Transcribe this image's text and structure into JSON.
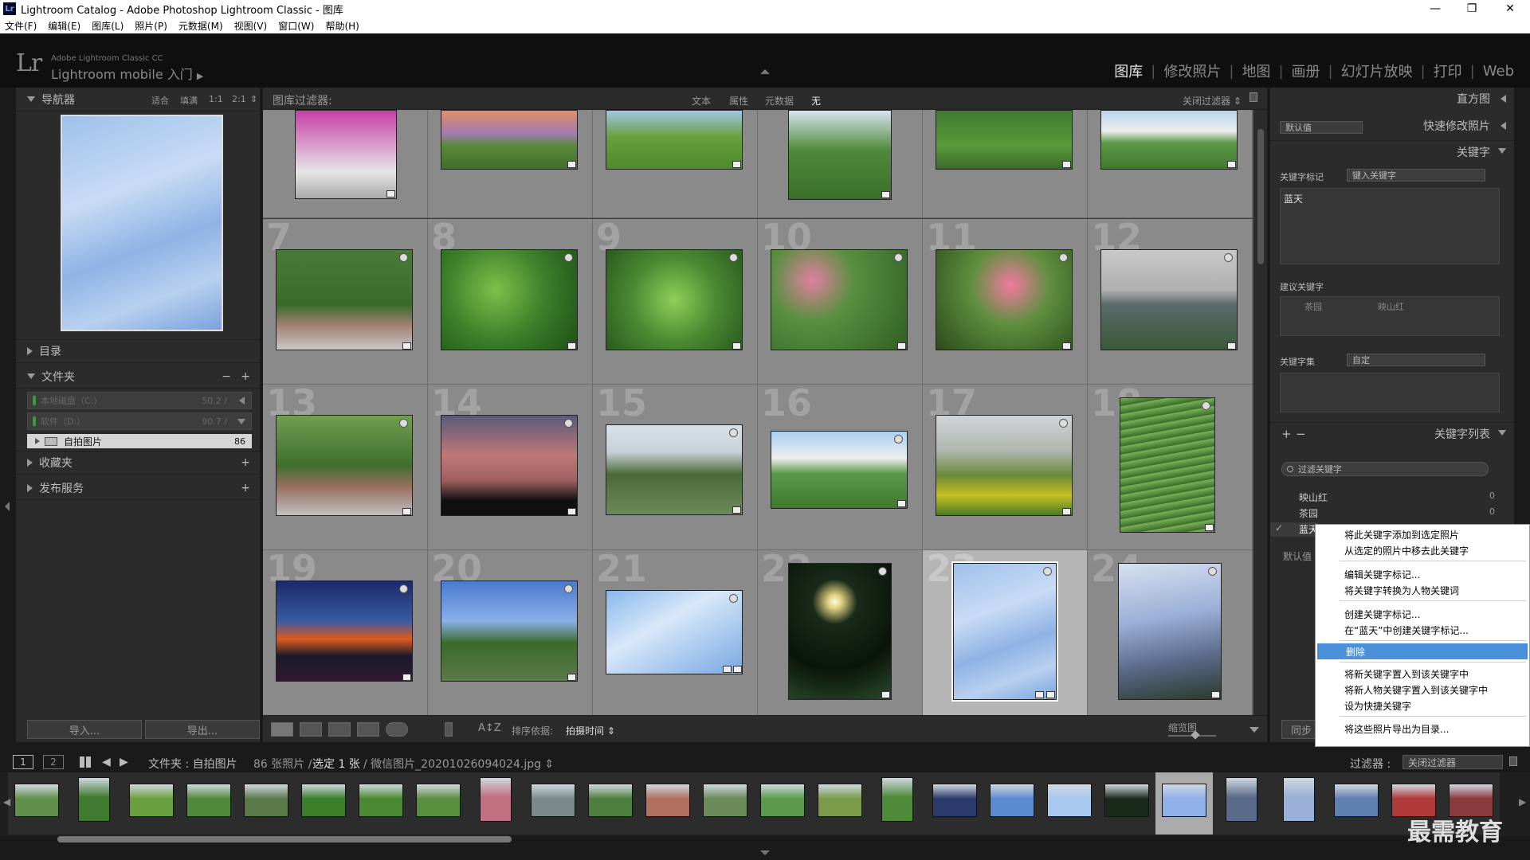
{
  "window": {
    "title": "Lightroom Catalog - Adobe Photoshop Lightroom Classic - 图库",
    "icon": "Lr",
    "controls": {
      "minimize": "—",
      "restore": "❐",
      "close": "✕"
    }
  },
  "menu": [
    "文件(F)",
    "编辑(E)",
    "图库(L)",
    "照片(P)",
    "元数据(M)",
    "视图(V)",
    "窗口(W)",
    "帮助(H)"
  ],
  "identity": {
    "logo": "Lr",
    "small": "Adobe Lightroom Classic CC",
    "main": "Lightroom mobile 入门",
    "arrow": "▶"
  },
  "modules": [
    "图库",
    "修改照片",
    "地图",
    "画册",
    "幻灯片放映",
    "打印",
    "Web"
  ],
  "module_separator": "|",
  "left_panel": {
    "navigator": {
      "title": "导航器",
      "options": [
        "适合",
        "填满",
        "1:1",
        "2:1"
      ],
      "dropdown": "⇕"
    },
    "catalog": {
      "title": "目录"
    },
    "folders": {
      "title": "文件夹",
      "controls": [
        "−",
        "+"
      ],
      "volumes": [
        {
          "name": "本地磁盘（C:）",
          "size": "50.2 /"
        },
        {
          "name": "软件（D:）",
          "size": "90.7 /"
        }
      ],
      "selected": {
        "name": "自拍图片",
        "count": "86"
      }
    },
    "collections": {
      "title": "收藏夹",
      "add": "+"
    },
    "publish": {
      "title": "发布服务",
      "add": "+"
    },
    "import_label": "导入...",
    "export_label": "导出..."
  },
  "filter_bar": {
    "label": "图库过滤器:",
    "options": [
      "文本",
      "属性",
      "元数据",
      "无"
    ],
    "active": "无",
    "right": "关闭过滤器 ⇕"
  },
  "grid": {
    "numbers": [
      "7",
      "8",
      "9",
      "10",
      "11",
      "12",
      "13",
      "14",
      "15",
      "16",
      "17",
      "18",
      "19",
      "20",
      "21",
      "22",
      "23",
      "24"
    ],
    "selected_cell": "23",
    "thumb_colors": [
      [
        "#c63fa8",
        "#e89060",
        "#6a9f3d",
        "#4f8a3a",
        "#3f7a2f",
        "#5f9a4a"
      ],
      [
        "#4a7a3a",
        "#3a7f2a",
        "#4b8a32",
        "#5a8f40",
        "#5f8f3f",
        "#8a8a8a"
      ],
      [
        "#4f7f3f",
        "#b07060",
        "#6a8a5a",
        "#5a9a4a",
        "#7a9a4a",
        "#4f8a3a"
      ],
      [
        "#2a3a6a",
        "#5a8ad0",
        "#a8c8ef",
        "#1a2a1a",
        "#8fb0e8",
        "#5a6a8a"
      ]
    ]
  },
  "toolbar": {
    "sort_label": "排序依据:",
    "sort_value": "拍摄时间 ⇕",
    "zoom_label": "缩览图",
    "ab": "A",
    "z": "Z"
  },
  "right_panel": {
    "histogram": {
      "title": "直方图"
    },
    "quick_develop": {
      "title": "快速修改照片",
      "preset": "默认值"
    },
    "keywording": {
      "title": "关键字",
      "tags_label": "关键字标记",
      "tags_select": "键入关键字",
      "tags_text": "蓝天",
      "suggestions_label": "建议关键字",
      "suggestions": [
        "茶园",
        "映山红"
      ],
      "set_label": "关键字集",
      "set_value": "自定"
    },
    "keyword_list": {
      "title": "关键字列表",
      "controls": [
        "+",
        "−"
      ],
      "filter_placeholder": "过滤关键字",
      "items": [
        {
          "name": "映山红",
          "count": "0"
        },
        {
          "name": "茶园",
          "count": "0"
        },
        {
          "name": "蓝天",
          "count": ""
        }
      ],
      "default_label": "默认值",
      "sync_label": "同步"
    }
  },
  "context_menu": {
    "items": [
      "将此关键字添加到选定照片",
      "从选定的照片中移去此关键字",
      "编辑关键字标记...",
      "将关键字转换为人物关键词",
      "创建关键字标记...",
      "在“蓝天”中创建关键字标记...",
      "删除",
      "将新关键字置入到该关键字中",
      "将新人物关键字置入到该关键字中",
      "设为快捷关键字",
      "将这些照片导出为目录..."
    ],
    "highlighted": "删除"
  },
  "secondary_bar": {
    "view1": "1",
    "view2": "2",
    "folder_label": "文件夹 : 自拍图片",
    "count": "86 张照片 /",
    "selected": "选定 1 张",
    "filename": "/ 微信图片_20201026094024.jpg ⇕",
    "filter_label": "过滤器 :",
    "filter_value": "关闭过滤器"
  },
  "filmstrip": {
    "colors": [
      "#5f8f4a",
      "#3f7a2f",
      "#6a9f3d",
      "#4f8a3a",
      "#5a7a4a",
      "#3a7f2a",
      "#4b8a32",
      "#5a8f40",
      "#c07080",
      "#7a8a8a",
      "#4f7f3f",
      "#b07060",
      "#6a8a5a",
      "#5a9a4a",
      "#7a9a4a",
      "#4f8a3a",
      "#2a3a6a",
      "#5a8ad0",
      "#a8c8ef",
      "#1a2a1a",
      "#8fb0e8",
      "#5a6a8a",
      "#9ab0d8",
      "#5f7fb0",
      "#b03a3a",
      "#8a3a3a"
    ]
  },
  "watermark": "最需教育"
}
